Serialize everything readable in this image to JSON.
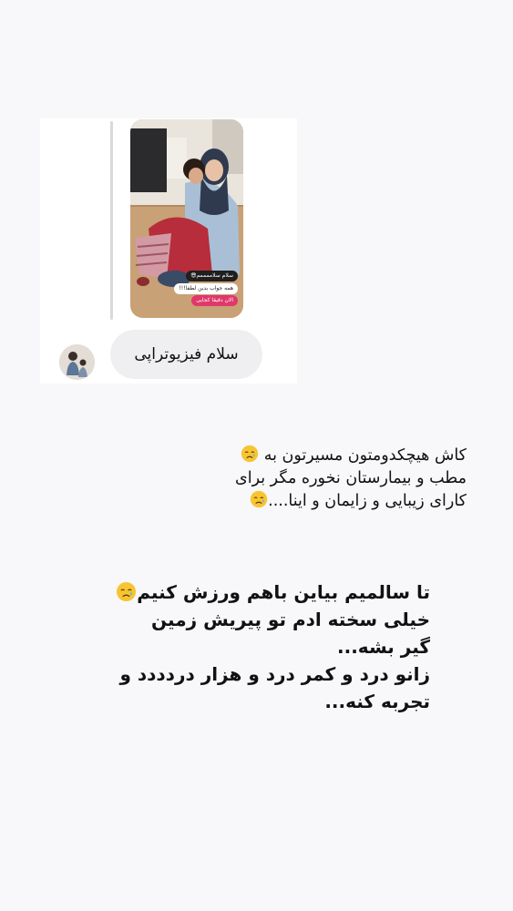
{
  "message_card": {
    "story_captions": [
      "سلام سلاممممم😎",
      "همه جواب بدین لطفا!!!",
      "الان دقیقا کجایی"
    ],
    "message_text": "سلام فیزیوتراپی"
  },
  "story_text": {
    "block1": {
      "lines": [
        "کاش هیچکدومتون مسیرتون به",
        "مطب و بیمارستان نخوره مگر برای",
        "کارای زیبایی و زایمان و اینا...."
      ]
    },
    "block2": {
      "lines": [
        "تا سالمیم بیاین باهم  ورزش کنیم",
        "خیلی سخته ادم تو پیریش زمین",
        "گیر بشه...",
        "زانو درد و کمر درد و هزار دردددد و",
        "تجربه کنه..."
      ]
    }
  },
  "icons": {
    "emoji": "crying-face-icon",
    "emoji_color": "#f7c531"
  }
}
